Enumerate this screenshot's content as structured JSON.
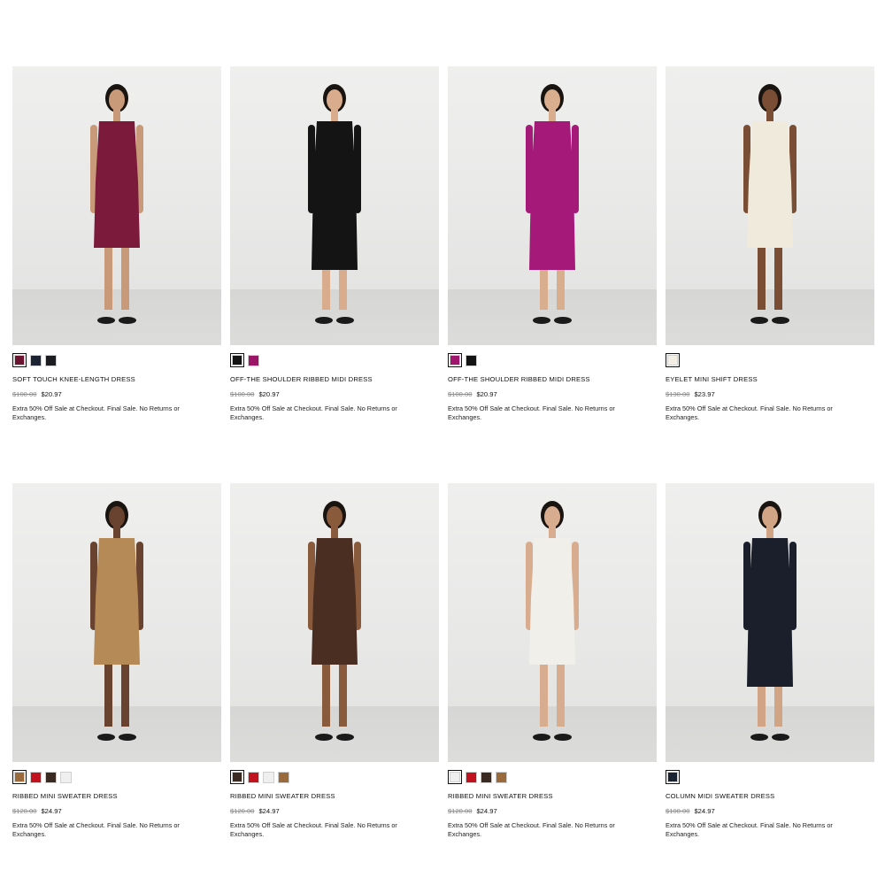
{
  "products": [
    {
      "name": "SOFT TOUCH KNEE-LENGTH DRESS",
      "original_price": "$100.00",
      "sale_price": "$20.97",
      "promo": "Extra 50% Off Sale at Checkout. Final Sale. No Returns or Exchanges.",
      "swatches": [
        "#6b1530",
        "#1d2333",
        "#1b1d21"
      ],
      "selected_swatch": 0,
      "dress_color": "#7c1a3c"
    },
    {
      "name": "OFF-THE SHOULDER RIBBED MIDI DRESS",
      "original_price": "$100.00",
      "sale_price": "$20.97",
      "promo": "Extra 50% Off Sale at Checkout. Final Sale. No Returns or Exchanges.",
      "swatches": [
        "#141414",
        "#9c1667"
      ],
      "selected_swatch": 0,
      "dress_color": "#141414"
    },
    {
      "name": "OFF-THE SHOULDER RIBBED MIDI DRESS",
      "original_price": "$100.00",
      "sale_price": "$20.97",
      "promo": "Extra 50% Off Sale at Checkout. Final Sale. No Returns or Exchanges.",
      "swatches": [
        "#a0156d",
        "#141414"
      ],
      "selected_swatch": 0,
      "dress_color": "#a51a79"
    },
    {
      "name": "EYELET MINI SHIFT DRESS",
      "original_price": "$130.00",
      "sale_price": "$23.97",
      "promo": "Extra 50% Off Sale at Checkout. Final Sale. No Returns or Exchanges.",
      "swatches": [
        "#f3efe4"
      ],
      "selected_swatch": 0,
      "dress_color": "#efeadc"
    },
    {
      "name": "RIBBED MINI SWEATER DRESS",
      "original_price": "$120.00",
      "sale_price": "$24.97",
      "promo": "Extra 50% Off Sale at Checkout. Final Sale. No Returns or Exchanges.",
      "swatches": [
        "#9a6a3c",
        "#c3121f",
        "#3b2a22",
        "#efefef"
      ],
      "selected_swatch": 0,
      "dress_color": "#b68a56"
    },
    {
      "name": "RIBBED MINI SWEATER DRESS",
      "original_price": "$120.00",
      "sale_price": "$24.97",
      "promo": "Extra 50% Off Sale at Checkout. Final Sale. No Returns or Exchanges.",
      "swatches": [
        "#3b2a22",
        "#c3121f",
        "#efefef",
        "#9a6a3c"
      ],
      "selected_swatch": 0,
      "dress_color": "#4a2e22"
    },
    {
      "name": "RIBBED MINI SWEATER DRESS",
      "original_price": "$120.00",
      "sale_price": "$24.97",
      "promo": "Extra 50% Off Sale at Checkout. Final Sale. No Returns or Exchanges.",
      "swatches": [
        "#efefef",
        "#c3121f",
        "#3b2a22",
        "#9a6a3c"
      ],
      "selected_swatch": 0,
      "dress_color": "#f1efea"
    },
    {
      "name": "COLUMN MIDI SWEATER DRESS",
      "original_price": "$100.00",
      "sale_price": "$24.97",
      "promo": "Extra 50% Off Sale at Checkout. Final Sale. No Returns or Exchanges.",
      "swatches": [
        "#1b2333"
      ],
      "selected_swatch": 0,
      "dress_color": "#1a1f2b"
    }
  ]
}
